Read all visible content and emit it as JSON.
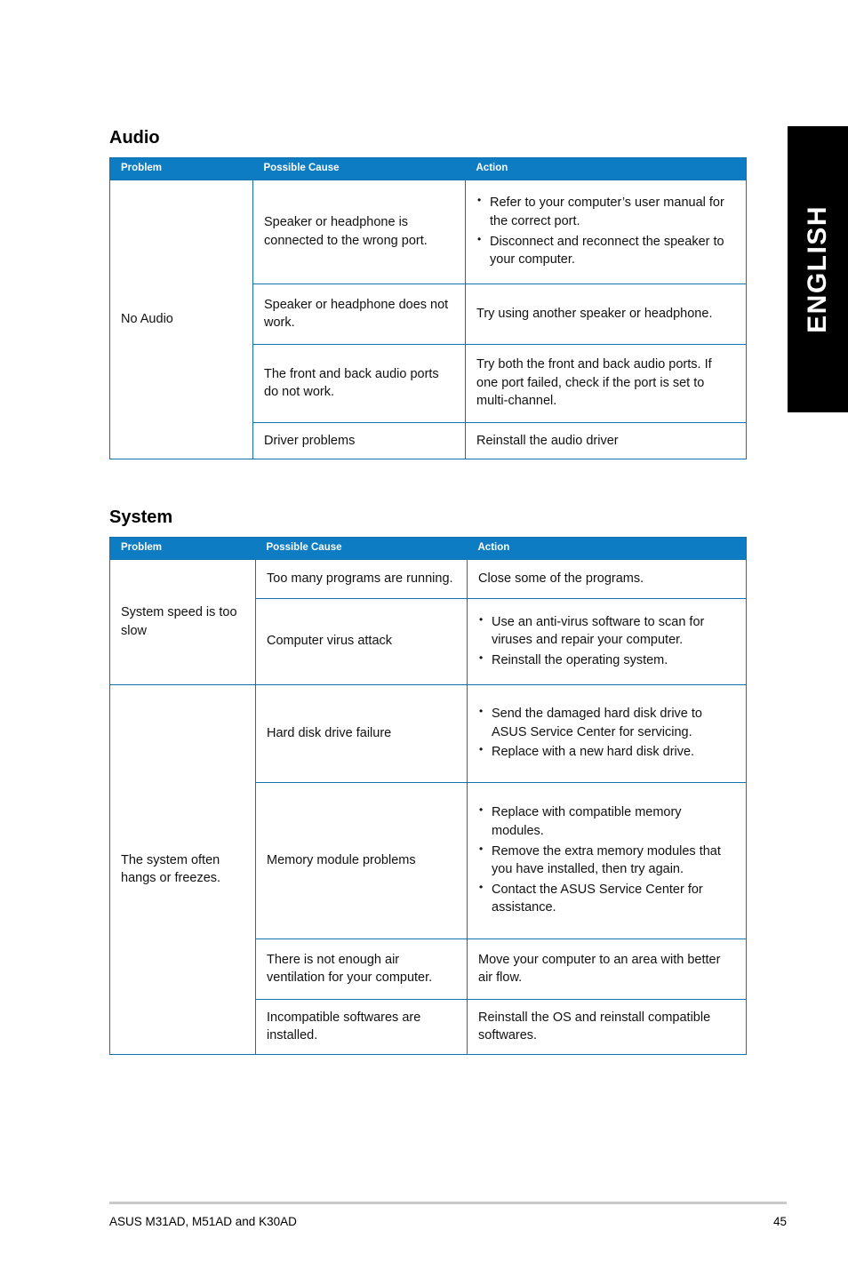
{
  "language_tab": {
    "label": "ENGLISH"
  },
  "sections": [
    {
      "id": "audio",
      "title": "Audio",
      "columns": [
        "Problem",
        "Possible Cause",
        "Action"
      ],
      "rows": [
        {
          "problem": "No Audio",
          "cause": "Speaker or headphone is connected to the wrong port.",
          "action_bullets": [
            "Refer to your computer’s user manual for the correct port.",
            "Disconnect and reconnect the speaker to your computer."
          ]
        },
        {
          "cause": "Speaker or headphone does not work.",
          "action": "Try using another speaker or headphone."
        },
        {
          "cause": "The front and back audio ports do not work.",
          "action": "Try both the front and back audio ports. If one port failed, check if the port is set to multi-channel."
        },
        {
          "cause": "Driver problems",
          "action": "Reinstall the audio driver"
        }
      ]
    },
    {
      "id": "system",
      "title": "System",
      "columns": [
        "Problem",
        "Possible Cause",
        "Action"
      ],
      "rows": [
        {
          "problem": "System speed is too slow",
          "cause": "Too many programs are running.",
          "action": "Close some of the programs."
        },
        {
          "cause": "Computer virus attack",
          "action_bullets": [
            "Use an anti-virus software to scan for viruses and repair your computer.",
            "Reinstall the operating system."
          ]
        },
        {
          "problem": "The system often hangs or freezes.",
          "cause": "Hard disk drive failure",
          "action_bullets": [
            "Send the damaged hard disk drive to ASUS Service Center for servicing.",
            "Replace with a new hard disk drive."
          ]
        },
        {
          "cause": "Memory module problems",
          "action_bullets": [
            "Replace with compatible memory modules.",
            "Remove the extra memory modules that you have installed, then try again.",
            "Contact the ASUS Service Center for assistance."
          ]
        },
        {
          "cause": "There is not enough air ventilation for your computer.",
          "action": "Move your computer to an area with better air flow."
        },
        {
          "cause": "Incompatible softwares are installed.",
          "action": "Reinstall the OS and reinstall compatible softwares."
        }
      ]
    }
  ],
  "footer": {
    "product": "ASUS M31AD, M51AD and K30AD",
    "page_number": "45"
  },
  "colors": {
    "header_blue": "#0d7cc2",
    "border_blue": "#1272ad",
    "tab_black": "#000000",
    "rule_gray": "#c9c9c9"
  }
}
